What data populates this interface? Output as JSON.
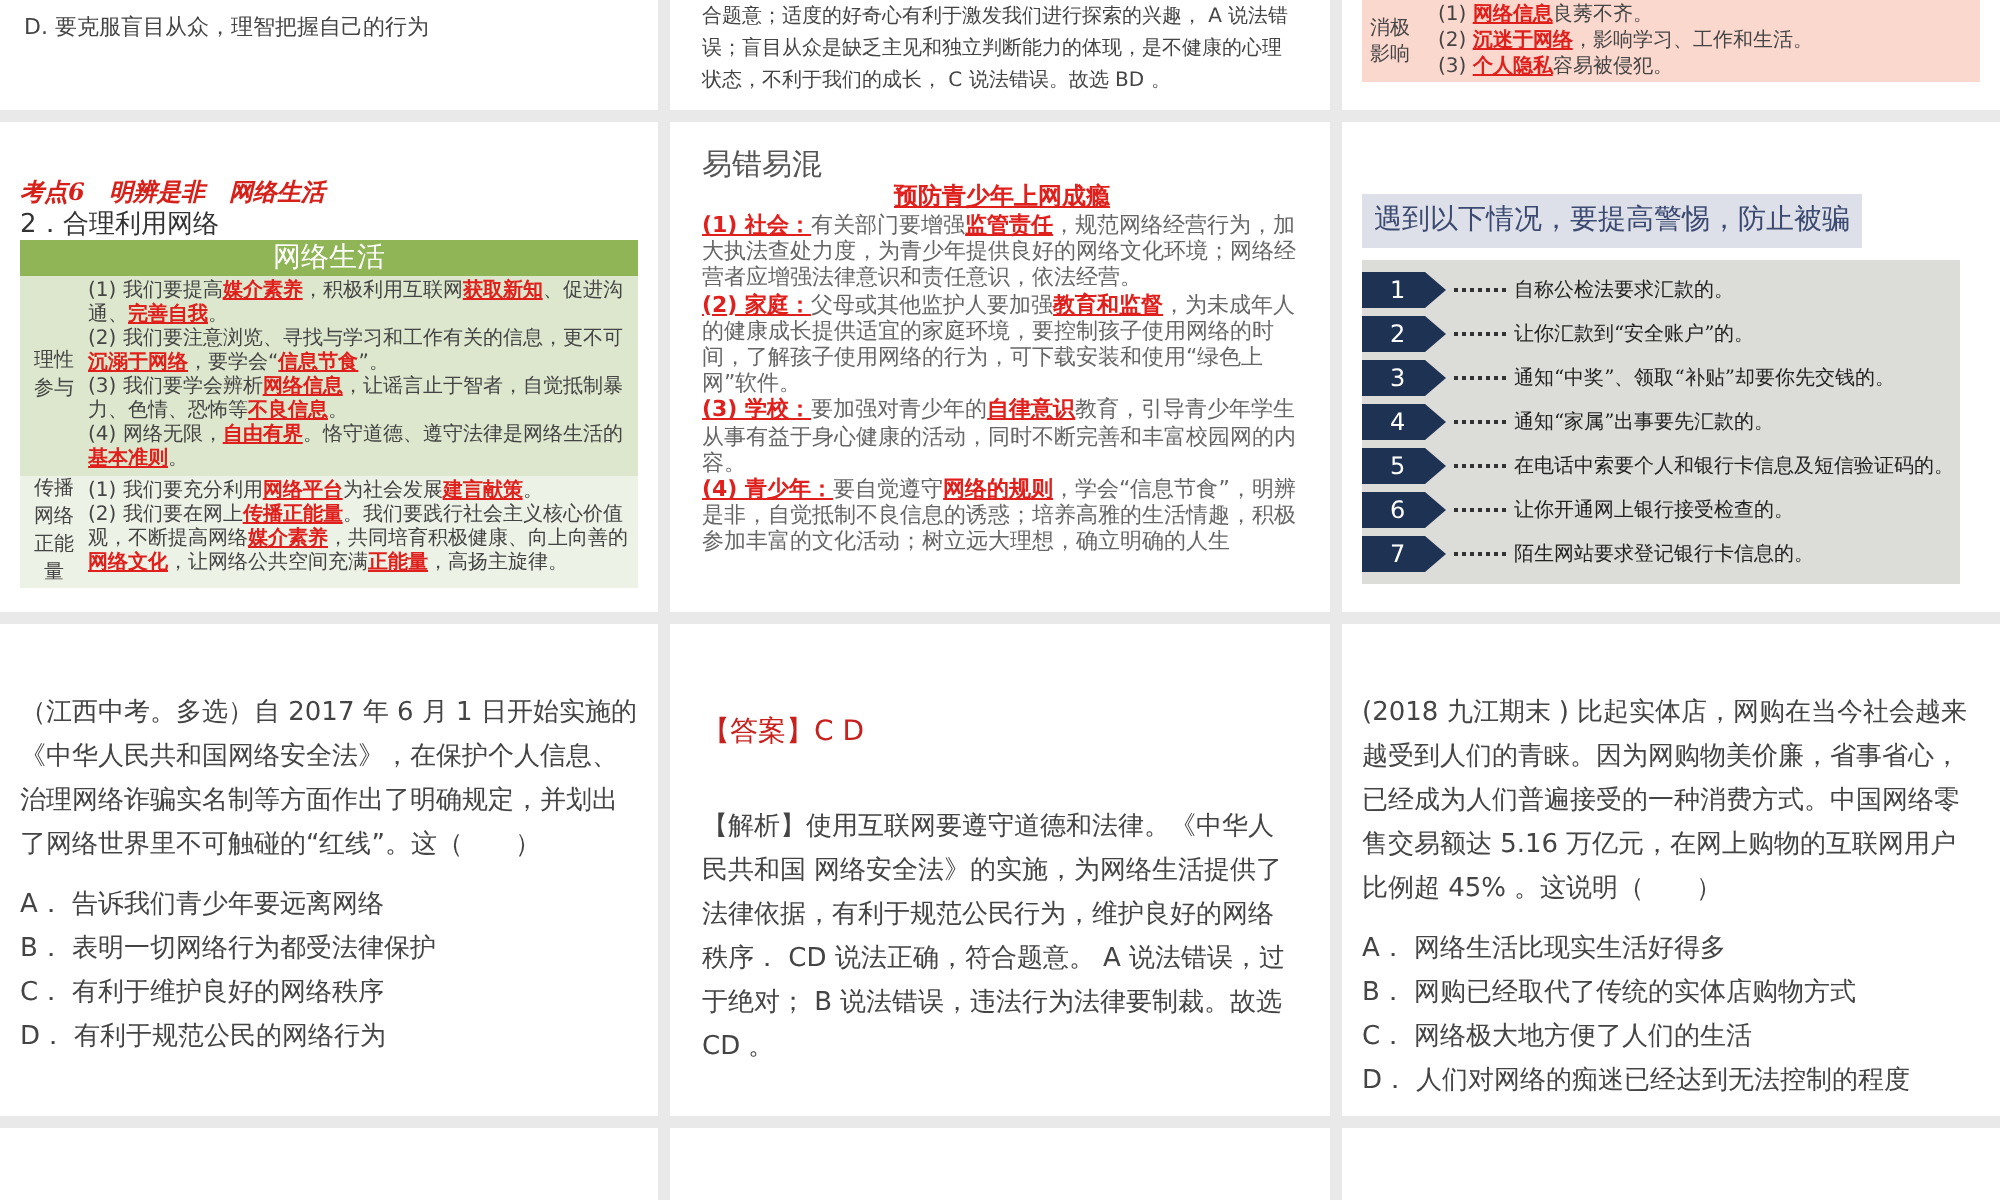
{
  "slides": [
    {
      "kind": "question_end",
      "lines": [
        "D. 要克服盲目从众，理智把握自己的行为"
      ]
    },
    {
      "kind": "analysis_end",
      "text": "合题意；适度的好奇心有利于激发我们进行探索的兴趣， A 说法错误；盲目从众是缺乏主见和独立判断能力的体现，是不健康的心理状态，不利于我们的成长， C 说法错误。故选 BD 。"
    },
    {
      "kind": "impact_table",
      "label": "消极影响",
      "items": [
        "(1) **网络信息**良莠不齐。",
        "(2) **沉迷于网络**，影响学习、工作和生活。",
        "(3) **个人隐私**容易被侵犯。"
      ]
    },
    {
      "kind": "topic_table",
      "topic": "考点6　明辨是非　网络生活",
      "subheading": "2．合理利用网络",
      "table_title": "网络生活",
      "rows": [
        {
          "label": "理性参与",
          "items": [
            "(1) 我们要提高**媒介素养**，积极利用互联网**获取新知**、促进沟通、**完善自我**。",
            "(2) 我们要注意浏览、寻找与学习和工作有关的信息，更不可**沉溺于网络**，要学会“**信息节食**”。",
            "(3) 我们要学会辨析**网络信息**，让谣言止于智者，自觉抵制暴力、色情、恐怖等**不良信息**。",
            "(4) 网络无限，**自由有界**。恪守道德、遵守法律是网络生活的**基本准则**。"
          ]
        },
        {
          "label": "传播网络正能量",
          "items": [
            "(1) 我们要充分利用**网络平台**为社会发展**建言献策**。",
            "(2) 我们要在网上**传播正能量**。我们要践行社会主义核心价值观，不断提高网络**媒介素养**，共同培育积极健康、向上向善的**网络文化**，让网络公共空间充满**正能量**，高扬主旋律。"
          ]
        }
      ]
    },
    {
      "kind": "notes",
      "heading": "易错易混",
      "title": "预防青少年上网成瘾",
      "items": [
        {
          "lead": "(1) 社会：",
          "text": "有关部门要增强**监管责任**，规范网络经营行为，加大执法查处力度，为青少年提供良好的网络文化环境；网络经营者应增强法律意识和责任意识，依法经营。"
        },
        {
          "lead": "(2) 家庭：",
          "text": "父母或其他监护人要加强**教育和监督**，为未成年人的健康成长提供适宜的家庭环境，要控制孩子使用网络的时间，了解孩子使用网络的行为，可下载安装和使用“绿色上网”软件。"
        },
        {
          "lead": "(3) 学校：",
          "text": "要加强对青少年的**自律意识**教育，引导青少年学生从事有益于身心健康的活动，同时不断完善和丰富校园网的内容。"
        },
        {
          "lead": "(4) 青少年：",
          "text": "要自觉遵守**网络的规则**，学会“信息节食”，明辨是非，自觉抵制不良信息的诱惑；培养高雅的生活情趣，积极参加丰富的文化活动；树立远大理想，确立明确的人生"
        }
      ]
    },
    {
      "kind": "warning_list",
      "title": "遇到以下情况，要提高警惕，防止被骗",
      "items": [
        {
          "number": "1",
          "text": "自称公检法要求汇款的。"
        },
        {
          "number": "2",
          "text": "让你汇款到“安全账户”的。"
        },
        {
          "number": "3",
          "text": "通知“中奖”、领取“补贴”却要你先交钱的。"
        },
        {
          "number": "4",
          "text": "通知“家属”出事要先汇款的。"
        },
        {
          "number": "5",
          "text": "在电话中索要个人和银行卡信息及短信验证码的。"
        },
        {
          "number": "6",
          "text": "让你开通网上银行接受检查的。"
        },
        {
          "number": "7",
          "text": "陌生网站要求登记银行卡信息的。"
        }
      ]
    },
    {
      "kind": "question",
      "stem": "（江西中考。多选）自 2017 年 6 月 1 日开始实施的《中华人民共和国网络安全法》，在保护个人信息、治理网络诈骗实名制等方面作出了明确规定，并划出了网络世界里不可触碰的“红线”。这（　　）",
      "options": [
        "A． 告诉我们青少年要远离网络",
        "B． 表明一切网络行为都受法律保护",
        "C． 有利于维护良好的网络秩序",
        "D． 有利于规范公民的网络行为"
      ]
    },
    {
      "kind": "answer",
      "answer_label": "【答案】",
      "answer": "C D",
      "explanation": "【解析】使用互联网要遵守道德和法律。《中华人民共和国 网络安全法》的实施，为网络生活提供了法律依据，有利于规范公民行为，维护良好的网络秩序． CD 说法正确，符合题意。 A 说法错误，过于绝对； B 说法错误，违法行为法律要制裁。故选 CD 。"
    },
    {
      "kind": "question",
      "stem": "(2018 九江期末 ) 比起实体店，网购在当今社会越来越受到人们的青睐。因为网购物美价廉，省事省心，已经成为人们普遍接受的一种消费方式。中国网络零售交易额达 5.16 万亿元，在网上购物的互联网用户比例超 45% 。这说明（　　）",
      "options": [
        "A． 网络生活比现实生活好得多",
        "B． 网购已经取代了传统的实体店购物方式",
        "C． 网络极大地方便了人们的生活",
        "D． 人们对网络的痴迷已经达到无法控制的程度"
      ]
    },
    {
      "kind": "blank"
    },
    {
      "kind": "blank"
    },
    {
      "kind": "blank"
    }
  ]
}
